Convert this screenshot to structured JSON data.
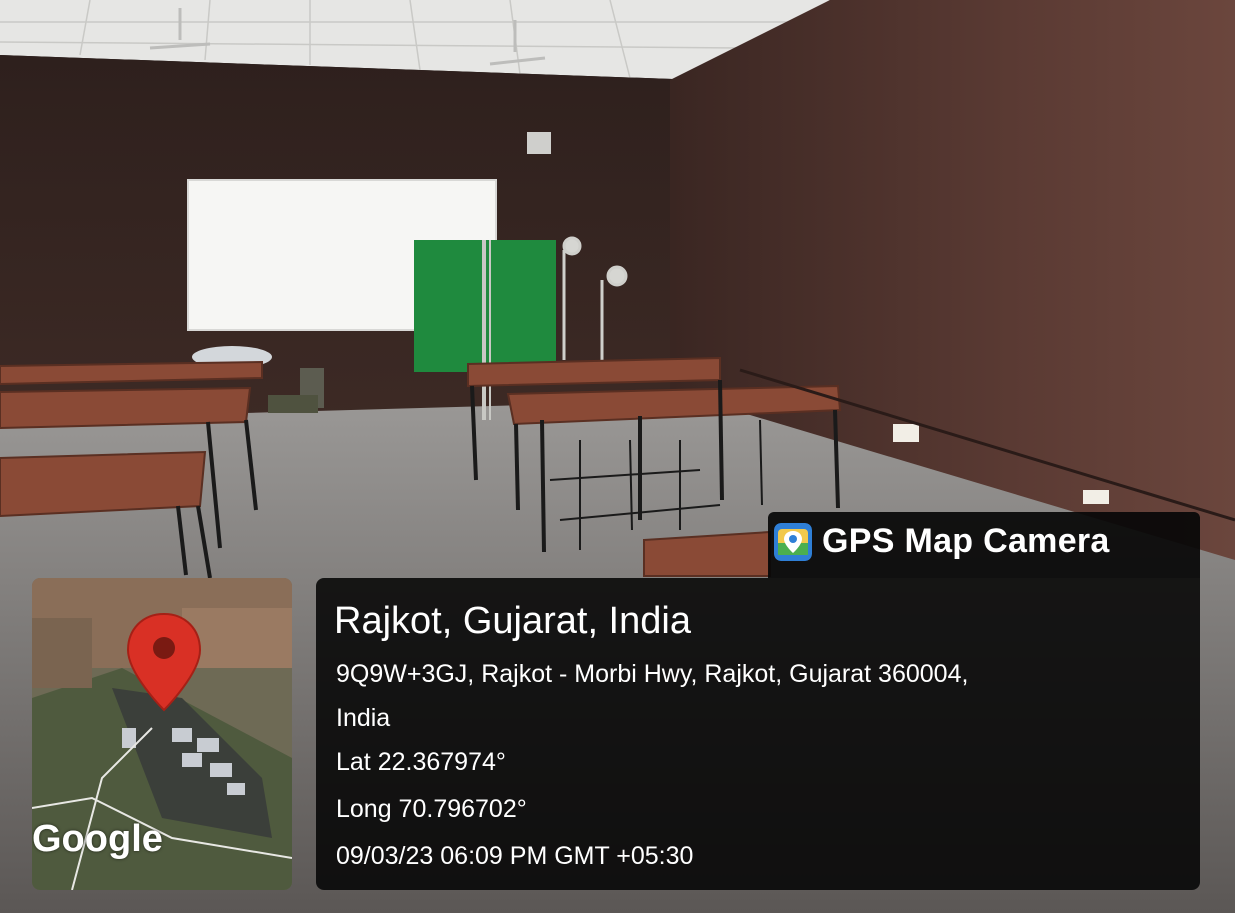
{
  "watermark": {
    "app_name": "GPS Map Camera",
    "icon": "gps-map-camera-app-icon"
  },
  "location": {
    "title": "Rajkot, Gujarat, India",
    "address_line1": "9Q9W+3GJ, Rajkot - Morbi Hwy, Rajkot, Gujarat 360004,",
    "address_line2": "India",
    "latitude": "Lat 22.367974°",
    "longitude": "Long 70.796702°",
    "datetime": "09/03/23 06:09 PM GMT +05:30"
  },
  "map": {
    "provider_logo": "Google",
    "pin_icon": "map-pin-icon",
    "pin_color": "#d93025"
  },
  "colors": {
    "wall": "#4a2f28",
    "panel_background": "#0a0a0a",
    "chroma_screen": "#1f8a3e",
    "table_top": "#8a4a36"
  }
}
